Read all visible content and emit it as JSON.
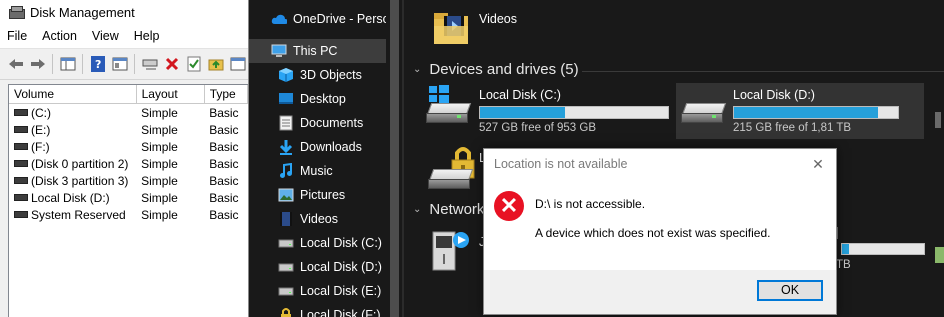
{
  "disk_management": {
    "title": "Disk Management",
    "menu": [
      "File",
      "Action",
      "View",
      "Help"
    ],
    "toolbar_icons": [
      "back-arrow-icon",
      "forward-arrow-icon",
      "console-tree-icon",
      "help-icon",
      "properties-icon",
      "connect-icon",
      "delete-icon",
      "check-icon",
      "folder-up-icon",
      "rescan-icon"
    ],
    "columns": [
      "Volume",
      "Layout",
      "Type"
    ],
    "rows": [
      {
        "volume": "(C:)",
        "layout": "Simple",
        "type": "Basic"
      },
      {
        "volume": "(E:)",
        "layout": "Simple",
        "type": "Basic"
      },
      {
        "volume": "(F:)",
        "layout": "Simple",
        "type": "Basic"
      },
      {
        "volume": "(Disk 0 partition 2)",
        "layout": "Simple",
        "type": "Basic"
      },
      {
        "volume": "(Disk 3 partition 3)",
        "layout": "Simple",
        "type": "Basic"
      },
      {
        "volume": "Local Disk (D:)",
        "layout": "Simple",
        "type": "Basic"
      },
      {
        "volume": "System Reserved",
        "layout": "Simple",
        "type": "Basic"
      }
    ]
  },
  "nav": {
    "items": [
      {
        "label": "OneDrive - Person",
        "icon": "cloud-icon"
      },
      {
        "label": "This PC",
        "icon": "computer-icon"
      },
      {
        "label": "3D Objects",
        "icon": "cube-icon"
      },
      {
        "label": "Desktop",
        "icon": "desktop-icon"
      },
      {
        "label": "Documents",
        "icon": "document-icon"
      },
      {
        "label": "Downloads",
        "icon": "download-icon"
      },
      {
        "label": "Music",
        "icon": "music-icon"
      },
      {
        "label": "Pictures",
        "icon": "pictures-icon"
      },
      {
        "label": "Videos",
        "icon": "video-icon"
      },
      {
        "label": "Local Disk (C:)",
        "icon": "drive-icon"
      },
      {
        "label": "Local Disk (D:)",
        "icon": "drive-icon"
      },
      {
        "label": "Local Disk (E:)",
        "icon": "drive-icon"
      },
      {
        "label": "Local Disk (F:)",
        "icon": "drive-icon"
      }
    ]
  },
  "content": {
    "videos_label": "Videos",
    "devices_header": "Devices and drives (5)",
    "network_header": "Network",
    "drives": [
      {
        "name": "Local Disk (C:)",
        "free": "527 GB free of 953 GB",
        "used_fraction": 0.45
      },
      {
        "name": "Local Disk (D:)",
        "free": "215 GB free of 1,81 TB",
        "used_fraction": 0.88
      }
    ],
    "partial_texts": {
      "lock_drive_letter": "L",
      "media_letter": "J",
      "tb_text": "TB"
    }
  },
  "dialog": {
    "title": "Location is not available",
    "message1": "D:\\ is not accessible.",
    "message2": "A device which does not exist was specified.",
    "ok_label": "OK"
  },
  "colors": {
    "accent": "#26a0da",
    "error": "#e81123",
    "explorer_bg": "#191919"
  }
}
